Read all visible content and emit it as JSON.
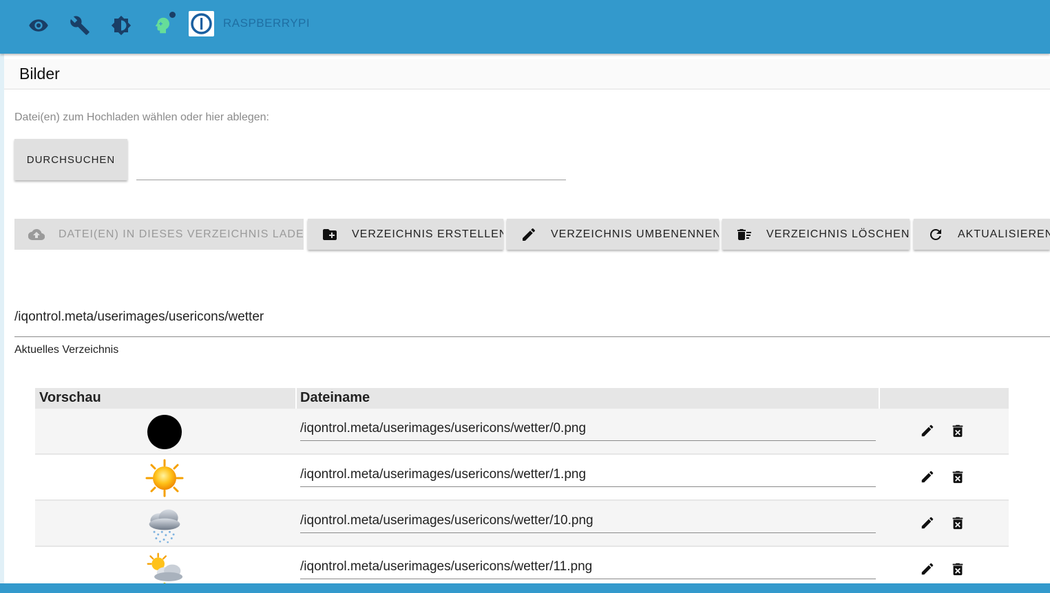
{
  "topbar": {
    "host": "RASPBERRYPI",
    "icons": [
      "eye-icon",
      "wrench-icon",
      "brightness-icon",
      "head-icon",
      "iobroker-logo"
    ],
    "colors": {
      "bar": "#3399cc",
      "head": "#66dd99"
    }
  },
  "page": {
    "title": "Bilder"
  },
  "upload": {
    "hint": "Datei(en) zum Hochladen wählen oder hier ablegen:",
    "browse_label": "DURCHSUCHEN"
  },
  "actions": {
    "upload": "DATEI(EN) IN DIESES VERZEICHNIS LADEN",
    "create": "VERZEICHNIS ERSTELLEN",
    "rename": "VERZEICHNIS UMBENENNEN",
    "delete": "VERZEICHNIS LÖSCHEN",
    "refresh": "AKTUALISIEREN"
  },
  "directory": {
    "path": "/iqontrol.meta/userimages/usericons/wetter",
    "label": "Aktuelles Verzeichnis"
  },
  "table": {
    "headers": {
      "preview": "Vorschau",
      "filename": "Dateiname"
    },
    "rows": [
      {
        "preview": "black-circle",
        "filename": "/iqontrol.meta/userimages/usericons/wetter/0.png"
      },
      {
        "preview": "sun-icon",
        "filename": "/iqontrol.meta/userimages/usericons/wetter/1.png"
      },
      {
        "preview": "rain-cloud-icon",
        "filename": "/iqontrol.meta/userimages/usericons/wetter/10.png"
      },
      {
        "preview": "sun-cloud-icon",
        "filename": "/iqontrol.meta/userimages/usericons/wetter/11.png"
      }
    ]
  }
}
